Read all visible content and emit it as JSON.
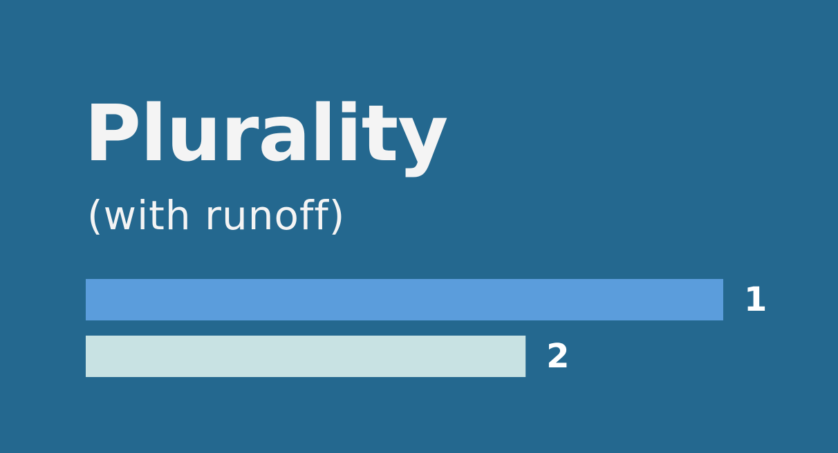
{
  "chart_data": {
    "type": "bar",
    "orientation": "horizontal",
    "title": "Plurality",
    "subtitle": "(with runoff)",
    "categories": [
      "1",
      "2"
    ],
    "values": [
      100,
      69
    ],
    "xlim": [
      0,
      100
    ],
    "grid": false,
    "colors": [
      "#5b9ddc",
      "#c8e2e3"
    ],
    "background": "#24688f",
    "text_color": "#f4f4f4"
  }
}
